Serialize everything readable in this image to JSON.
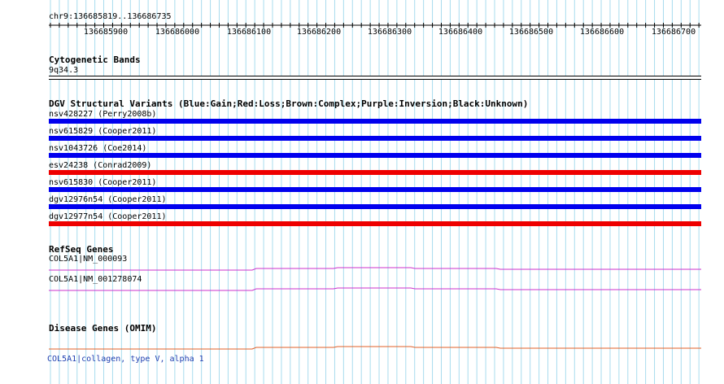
{
  "ruler": {
    "location": "chr9:136685819..136686735",
    "ticks": [
      "136685900",
      "136686000",
      "136686100",
      "136686200",
      "136686300",
      "136686400",
      "136686500",
      "136686600",
      "136686700"
    ]
  },
  "cytoband_track": {
    "title": "Cytogenetic Bands",
    "band": "9q34.3"
  },
  "dgv_track": {
    "title": "DGV Structural Variants (Blue:Gain;Red:Loss;Brown:Complex;Purple:Inversion;Black:Unknown)",
    "colors": {
      "gain": "#0000ee",
      "loss": "#ee0000"
    },
    "variants": [
      {
        "label": "nsv428227 (Perry2008b)",
        "type": "gain"
      },
      {
        "label": "nsv615829 (Cooper2011)",
        "type": "gain"
      },
      {
        "label": "nsv1043726 (Coe2014)",
        "type": "gain"
      },
      {
        "label": "esv24238 (Conrad2009)",
        "type": "loss"
      },
      {
        "label": "nsv615830 (Cooper2011)",
        "type": "gain"
      },
      {
        "label": "dgv12976n54 (Cooper2011)",
        "type": "gain"
      },
      {
        "label": "dgv12977n54 (Cooper2011)",
        "type": "loss"
      }
    ]
  },
  "refseq_track": {
    "title": "RefSeq Genes",
    "color": "#cc33cc",
    "genes": [
      {
        "label": "COL5A1|NM_000093"
      },
      {
        "label": "COL5A1|NM_001278074"
      }
    ]
  },
  "omim_track": {
    "title": "Disease Genes (OMIM)",
    "color": "#e0602a",
    "genes": [
      {
        "label": "COL5A1|collagen, type V, alpha 1"
      }
    ]
  }
}
